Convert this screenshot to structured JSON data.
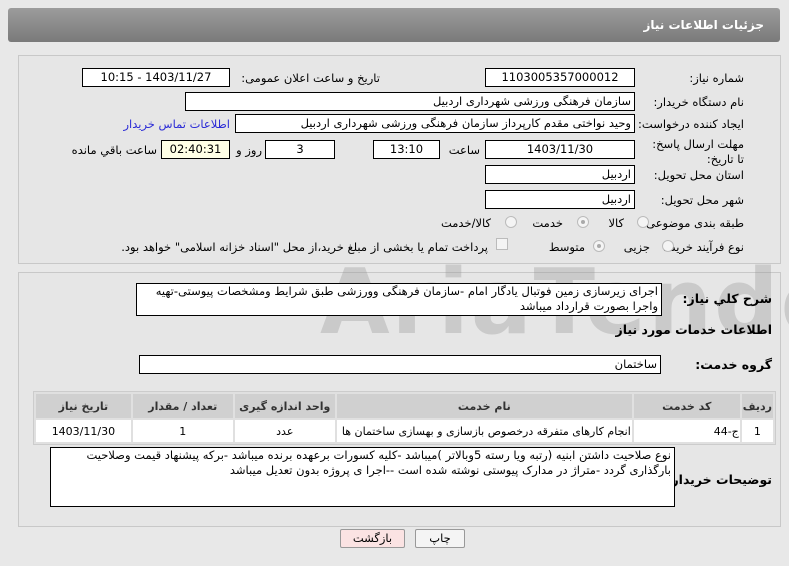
{
  "header": {
    "title": "جزئیات اطلاعات نیاز"
  },
  "watermark": "AriaTender.neT",
  "fields": {
    "need_number_label": "شماره نیاز:",
    "need_number": "1103005357000012",
    "announce_label": "تاریخ و ساعت اعلان عمومی:",
    "announce": "1403/11/27 - 10:15",
    "buyer_label": "نام دستگاه خریدار:",
    "buyer": "سازمان فرهنگی ورزشی شهرداری اردبیل",
    "creator_label": "ایجاد کننده درخواست:",
    "creator": "وحید نواختی مقدم کارپرداز سازمان فرهنگی ورزشی شهرداری اردبیل",
    "contact_link": "اطلاعات تماس خریدار",
    "deadline_label": "مهلت ارسال پاسخ: تا تاریخ:",
    "deadline_date": "1403/11/30",
    "time_label": "ساعت",
    "deadline_time": "13:10",
    "days": "3",
    "days_label": "روز و",
    "remaining": "02:40:31",
    "remaining_label": "ساعت باقي مانده",
    "province_label": "استان محل تحویل:",
    "province": "اردبیل",
    "city_label": "شهر محل تحویل:",
    "city": "اردبیل",
    "category_label": "طبقه بندی موضوعی:",
    "category_options": [
      "کالا",
      "خدمت",
      "کالا/خدمت"
    ],
    "category_selected": "خدمت",
    "process_label": "نوع فرآیند خرید :",
    "process_options": [
      "جزیی",
      "متوسط"
    ],
    "process_selected": "متوسط",
    "payment_note": "پرداخت تمام یا بخشی از مبلغ خرید،از محل \"اسناد خزانه اسلامی\" خواهد بود."
  },
  "details": {
    "desc_label": "شرح کلي نیاز:",
    "desc": "اجرای زیرسازی زمین فوتبال یادگار امام -سازمان فرهنگی وورزشی طبق شرایط ومشخصات پیوستی-تهیه واجرا بصورت قرارداد میباشد",
    "services_title": "اطلاعات خدمات مورد نیاز",
    "group_label": "گروه خدمت:",
    "group": "ساختمان",
    "table": {
      "headers": [
        "ردیف",
        "کد خدمت",
        "نام خدمت",
        "واحد اندازه گیری",
        "تعداد / مقدار",
        "تاریخ نیاز"
      ],
      "rows": [
        [
          "1",
          "ج-44",
          "انجام کارهای متفرقه درخصوص بازسازی و بهسازی ساختمان ها",
          "عدد",
          "1",
          "1403/11/30"
        ]
      ]
    },
    "notes_label": "توضیحات خریدار:",
    "notes": "نوع صلاحیت داشتن ابنیه (رتبه ویا رسته 5وبالاتر )میباشد -کلیه کسورات برعهده برنده میباشد -برکه پیشنهاد قیمت وصلاحیت بارگذاری گردد -متراژ در مدارک پیوستی نوشته شده است --اجرا ی پروژه بدون تعدیل میباشد"
  },
  "buttons": {
    "print": "چاپ",
    "back": "بازگشت"
  }
}
